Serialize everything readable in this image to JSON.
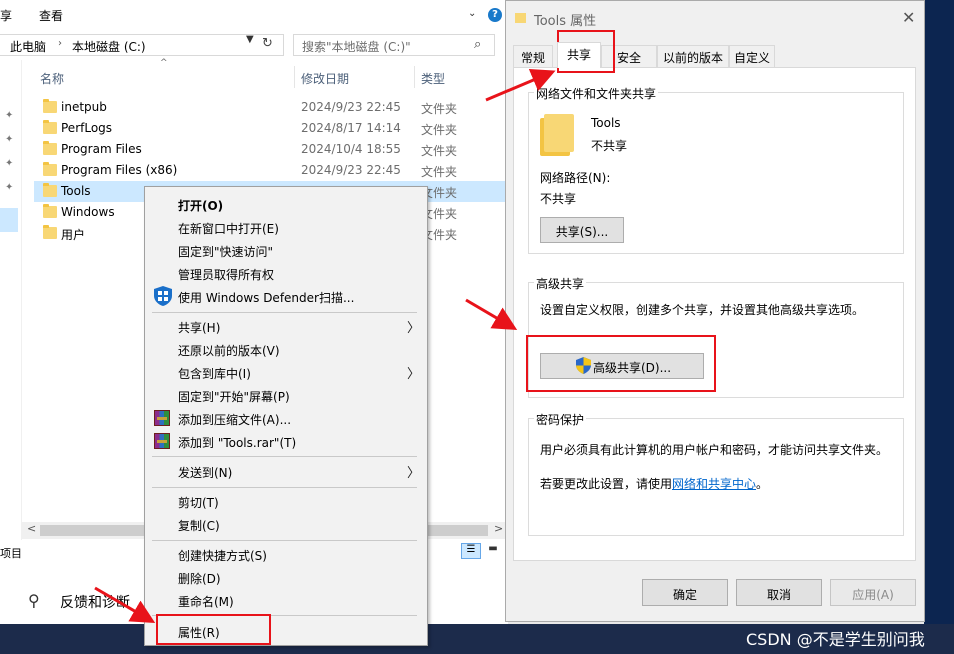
{
  "explorer": {
    "menu": [
      "享",
      "查看"
    ],
    "breadcrumb": [
      "此电脑",
      "本地磁盘 (C:)"
    ],
    "search_placeholder": "搜索\"本地磁盘 (C:)\"",
    "columns": {
      "name": "名称",
      "date": "修改日期",
      "type": "类型"
    },
    "rows": [
      {
        "name": "inetpub",
        "date": "2024/9/23 22:45",
        "type": "文件夹"
      },
      {
        "name": "PerfLogs",
        "date": "2024/8/17 14:14",
        "type": "文件夹"
      },
      {
        "name": "Program Files",
        "date": "2024/10/4 18:55",
        "type": "文件夹"
      },
      {
        "name": "Program Files (x86)",
        "date": "2024/9/23 22:45",
        "type": "文件夹"
      },
      {
        "name": "Tools",
        "date": "",
        "type": "文件夹"
      },
      {
        "name": "Windows",
        "date": "",
        "type": "文件夹"
      },
      {
        "name": "用户",
        "date": "",
        "type": "文件夹"
      }
    ],
    "status": "项目"
  },
  "taskarea": {
    "feedback": "反馈和诊断"
  },
  "watermark": "CSDN @不是学生别问我",
  "context_menu": {
    "open": "打开(O)",
    "open_new_window": "在新窗口中打开(E)",
    "pin_quick_access": "固定到\"快速访问\"",
    "take_ownership": "管理员取得所有权",
    "defender_scan": "使用 Windows Defender扫描...",
    "share": "共享(H)",
    "restore_versions": "还原以前的版本(V)",
    "include_library": "包含到库中(I)",
    "pin_start": "固定到\"开始\"屏幕(P)",
    "add_archive": "添加到压缩文件(A)...",
    "add_rar": "添加到 \"Tools.rar\"(T)",
    "send_to": "发送到(N)",
    "cut": "剪切(T)",
    "copy": "复制(C)",
    "create_shortcut": "创建快捷方式(S)",
    "delete": "删除(D)",
    "rename": "重命名(M)",
    "properties": "属性(R)"
  },
  "dialog": {
    "title": "Tools 属性",
    "tabs": [
      "常规",
      "共享",
      "安全",
      "以前的版本",
      "自定义"
    ],
    "network_group": "网络文件和文件夹共享",
    "folder_name": "Tools",
    "share_status": "不共享",
    "network_path_label": "网络路径(N):",
    "network_path_value": "不共享",
    "share_button": "共享(S)...",
    "advanced_group": "高级共享",
    "advanced_desc": "设置自定义权限，创建多个共享，并设置其他高级共享选项。",
    "advanced_button": "高级共享(D)...",
    "password_group": "密码保护",
    "password_desc": "用户必须具有此计算机的用户帐户和密码，才能访问共享文件夹。",
    "password_change_prefix": "若要更改此设置，请使用",
    "password_link": "网络和共享中心",
    "password_change_suffix": "。",
    "ok": "确定",
    "cancel": "取消",
    "apply": "应用(A)"
  },
  "colors": {
    "annotation_red": "#e8131a",
    "selection": "#cce8ff",
    "link": "#0066cc"
  }
}
